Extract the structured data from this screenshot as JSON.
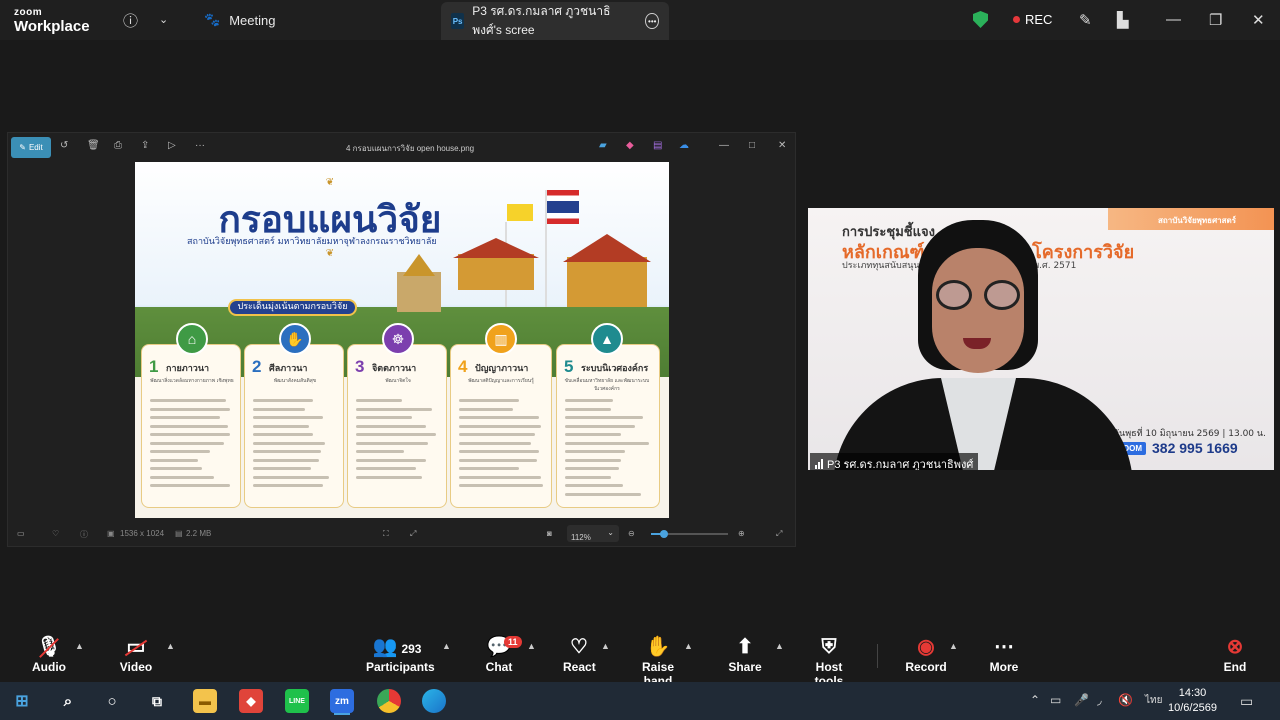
{
  "app": {
    "logo_line1": "zoom",
    "logo_line2": "Workplace"
  },
  "header": {
    "meeting_label": "Meeting",
    "share_tab_badge": "Ps",
    "share_tab_label": "P3 รศ.ดร.กมลาศ ภูวชนาธิพงศ์'s scree",
    "rec_label": "REC"
  },
  "viewer": {
    "edit_label": "Edit",
    "file_title": "4 กรอบแผนการวิจัย open house.png",
    "dimensions": "1536 x 1024",
    "file_size": "2.2 MB",
    "zoom_level": "112%"
  },
  "poster": {
    "title": "กรอบแผนวิจัย",
    "subtitle": "สถาบันวิจัยพุทธศาสตร์ มหาวิทยาลัยมหาจุฬาลงกรณราชวิทยาลัย",
    "banner": "ประเด็นมุ่งเน้นตามกรอบวิจัย",
    "cards": [
      {
        "num": "1",
        "name": "กายภาวนา",
        "desc": "พัฒนาสิ่งแวดล้อมทางกายภาพ เชิงพุทธ",
        "color": "#3f9a45"
      },
      {
        "num": "2",
        "name": "ศีลภาวนา",
        "desc": "พัฒนาสังคมสันติสุข",
        "color": "#2b6fbf"
      },
      {
        "num": "3",
        "name": "จิตตภาวนา",
        "desc": "พัฒนาจิตใจ",
        "color": "#7c3fae"
      },
      {
        "num": "4",
        "name": "ปัญญาภาวนา",
        "desc": "พัฒนาสติปัญญาและการเรียนรู้",
        "color": "#f0a21c"
      },
      {
        "num": "5",
        "name": "ระบบนิเวศองค์กร",
        "desc": "ขับเคลื่อนมหาวิทยาลัย และพัฒนาระบบนิเวศองค์กร",
        "color": "#1f8b8f"
      }
    ]
  },
  "video": {
    "institute": "สถาบันวิจัยพุทธศาสตร์",
    "line1": "การประชุมชี้แจง",
    "line2": "หลักเกณฑ์ต        งบประมาณโครงการวิจัย",
    "line3": "ประเภททุนสนับสนุน        (Fund) ประจำปีงบประมาณ พ.ศ. 2571",
    "date": "วันพุธที่ 10 มิถุนายน 2569 | 13.00 น.",
    "zoom_badge": "ZOOM",
    "zoom_id": "382 995 1669",
    "participant_name": "P3 รศ.ดร.กมลาศ ภูวชนาธิพงศ์"
  },
  "toolbar": {
    "audio": "Audio",
    "video": "Video",
    "participants": "Participants",
    "participants_count": "293",
    "chat": "Chat",
    "chat_badge": "11",
    "react": "React",
    "raise_hand": "Raise hand",
    "share": "Share",
    "host_tools": "Host tools",
    "record": "Record",
    "more": "More",
    "end": "End"
  },
  "taskbar": {
    "zoom_app": "zm",
    "time": "14:30",
    "date": "10/6/2569",
    "lang": "ไทย"
  },
  "colors": {
    "accent_blue": "#3b8fb6",
    "rec_red": "#e5383b",
    "secure_green": "#2bb15a",
    "end_red": "#e53935"
  }
}
